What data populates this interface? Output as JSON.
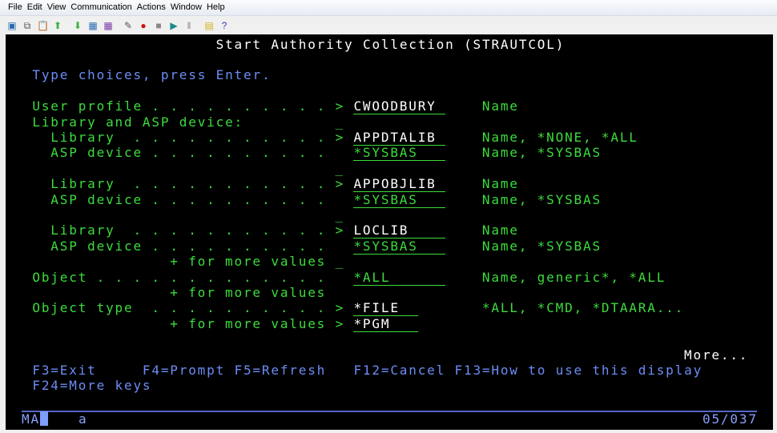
{
  "menu": [
    "File",
    "Edit",
    "View",
    "Communication",
    "Actions",
    "Window",
    "Help"
  ],
  "toolbar_icons": [
    "copy-screen-icon",
    "copy-icon",
    "paste-icon",
    "send-icon",
    "receive-icon",
    "display-keypad-icon",
    "spreadsheet-icon",
    "macro-edit-icon",
    "record-macro-icon",
    "stop-macro-icon",
    "play-macro-icon",
    "pause-macro-icon",
    "notes-icon",
    "help-icon"
  ],
  "colors": {
    "green": "#3cdc3c",
    "white": "#ffffff",
    "blue": "#6d8cf5",
    "background": "#000000"
  },
  "screen": {
    "rows": [
      {
        "row": 1,
        "segs": [
          {
            "col": 23,
            "text": "Start Authority Collection (STRAUTCOL)",
            "c": "w",
            "name": "screen-title"
          }
        ]
      },
      {
        "row": 3,
        "segs": [
          {
            "col": 3,
            "text": "Type choices, press Enter.",
            "c": "b",
            "name": "instructions"
          }
        ]
      },
      {
        "row": 5,
        "segs": [
          {
            "col": 3,
            "text": "User profile . . . . . . . . . . >",
            "c": "g",
            "name": "label-user-profile"
          },
          {
            "col": 38,
            "text": "CWOODBURY",
            "c": "w",
            "field": 10,
            "name": "user-profile-input"
          },
          {
            "col": 52,
            "text": "Name",
            "c": "g",
            "name": "hint"
          }
        ]
      },
      {
        "row": 6,
        "segs": [
          {
            "col": 3,
            "text": "Library and ASP device:",
            "c": "g",
            "name": "label-library-asp"
          },
          {
            "col": 36,
            "text": "_",
            "c": "g",
            "name": "more-marker"
          }
        ]
      },
      {
        "row": 7,
        "segs": [
          {
            "col": 5,
            "text": "Library  . . . . . . . . . . . >",
            "c": "g",
            "name": "label-library"
          },
          {
            "col": 38,
            "text": "APPDTALIB",
            "c": "w",
            "field": 10,
            "name": "library-input-1"
          },
          {
            "col": 52,
            "text": "Name, *NONE, *ALL",
            "c": "g",
            "name": "hint"
          }
        ]
      },
      {
        "row": 8,
        "segs": [
          {
            "col": 5,
            "text": "ASP device . . . . . . . . . .",
            "c": "g",
            "name": "label-asp-device"
          },
          {
            "col": 38,
            "text": "*SYSBAS",
            "c": "g",
            "field": 10,
            "name": "asp-device-input-1"
          },
          {
            "col": 52,
            "text": "Name, *SYSBAS",
            "c": "g",
            "name": "hint"
          }
        ]
      },
      {
        "row": 9,
        "segs": [
          {
            "col": 36,
            "text": "_",
            "c": "g",
            "name": "more-marker"
          }
        ]
      },
      {
        "row": 10,
        "segs": [
          {
            "col": 5,
            "text": "Library  . . . . . . . . . . . >",
            "c": "g",
            "name": "label-library"
          },
          {
            "col": 38,
            "text": "APPOBJLIB",
            "c": "w",
            "field": 10,
            "name": "library-input-2"
          },
          {
            "col": 52,
            "text": "Name",
            "c": "g",
            "name": "hint"
          }
        ]
      },
      {
        "row": 11,
        "segs": [
          {
            "col": 5,
            "text": "ASP device . . . . . . . . . .",
            "c": "g",
            "name": "label-asp-device"
          },
          {
            "col": 38,
            "text": "*SYSBAS",
            "c": "g",
            "field": 10,
            "name": "asp-device-input-2"
          },
          {
            "col": 52,
            "text": "Name, *SYSBAS",
            "c": "g",
            "name": "hint"
          }
        ]
      },
      {
        "row": 12,
        "segs": [
          {
            "col": 36,
            "text": "_",
            "c": "g",
            "name": "more-marker"
          }
        ]
      },
      {
        "row": 13,
        "segs": [
          {
            "col": 5,
            "text": "Library  . . . . . . . . . . . >",
            "c": "g",
            "name": "label-library"
          },
          {
            "col": 38,
            "text": "LOCLIB",
            "c": "w",
            "field": 10,
            "name": "library-input-3"
          },
          {
            "col": 52,
            "text": "Name",
            "c": "g",
            "name": "hint"
          }
        ]
      },
      {
        "row": 14,
        "segs": [
          {
            "col": 5,
            "text": "ASP device . . . . . . . . . .",
            "c": "g",
            "name": "label-asp-device"
          },
          {
            "col": 38,
            "text": "*SYSBAS",
            "c": "g",
            "field": 10,
            "name": "asp-device-input-3"
          },
          {
            "col": 52,
            "text": "Name, *SYSBAS",
            "c": "g",
            "name": "hint"
          }
        ]
      },
      {
        "row": 15,
        "segs": [
          {
            "col": 18,
            "text": "+ for more values _",
            "c": "g",
            "name": "more-values-label"
          }
        ]
      },
      {
        "row": 16,
        "segs": [
          {
            "col": 3,
            "text": "Object . . . . . . . . . . . . .",
            "c": "g",
            "name": "label-object"
          },
          {
            "col": 38,
            "text": "*ALL",
            "c": "g",
            "field": 10,
            "name": "object-input"
          },
          {
            "col": 52,
            "text": "Name, generic*, *ALL",
            "c": "g",
            "name": "hint"
          }
        ]
      },
      {
        "row": 17,
        "segs": [
          {
            "col": 18,
            "text": "+ for more values",
            "c": "g",
            "name": "more-values-label"
          },
          {
            "col": 38,
            "text": "",
            "c": "g",
            "field": 10,
            "name": "object-more-input"
          }
        ]
      },
      {
        "row": 18,
        "segs": [
          {
            "col": 3,
            "text": "Object type  . . . . . . . . . . >",
            "c": "g",
            "name": "label-object-type"
          },
          {
            "col": 38,
            "text": "*FILE",
            "c": "w",
            "field": 7,
            "name": "object-type-input-1"
          },
          {
            "col": 52,
            "text": "*ALL, *CMD, *DTAARA...",
            "c": "g",
            "name": "hint"
          }
        ]
      },
      {
        "row": 19,
        "segs": [
          {
            "col": 18,
            "text": "+ for more values >",
            "c": "g",
            "name": "more-values-label"
          },
          {
            "col": 38,
            "text": "*PGM",
            "c": "w",
            "field": 7,
            "name": "object-type-input-2"
          }
        ]
      },
      {
        "row": 21,
        "segs": [
          {
            "col": 74,
            "text": "More...",
            "c": "w",
            "name": "more-indicator"
          }
        ]
      },
      {
        "row": 22,
        "segs": [
          {
            "col": 3,
            "text": "F3=Exit",
            "c": "b",
            "name": "f3-exit",
            "i": true
          },
          {
            "col": 15,
            "text": "F4=Prompt",
            "c": "b",
            "name": "f4-prompt",
            "i": true
          },
          {
            "col": 25,
            "text": "F5=Refresh",
            "c": "b",
            "name": "f5-refresh",
            "i": true
          },
          {
            "col": 38,
            "text": "F12=Cancel",
            "c": "b",
            "name": "f12-cancel",
            "i": true
          },
          {
            "col": 49,
            "text": "F13=How to use this display",
            "c": "b",
            "name": "f13-help",
            "i": true
          }
        ]
      },
      {
        "row": 23,
        "segs": [
          {
            "col": 3,
            "text": "F24=More keys",
            "c": "b",
            "name": "f24-more-keys",
            "i": true
          }
        ]
      }
    ]
  },
  "status": {
    "left": "MA",
    "cursor_char": "",
    "indicator": "a",
    "position": "05/037"
  }
}
